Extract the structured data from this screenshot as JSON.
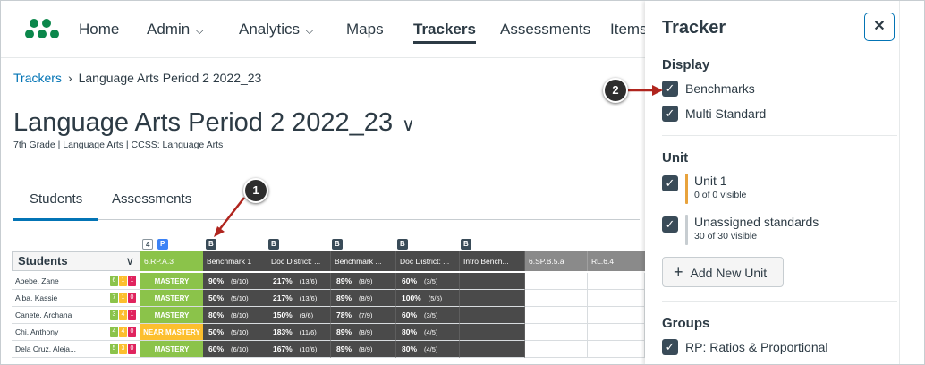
{
  "nav": {
    "items": [
      {
        "label": "Home"
      },
      {
        "label": "Admin"
      },
      {
        "label": "Analytics"
      },
      {
        "label": "Maps"
      },
      {
        "label": "Trackers"
      },
      {
        "label": "Assessments"
      },
      {
        "label": "Items"
      }
    ],
    "active": "Trackers"
  },
  "breadcrumb": {
    "parent": "Trackers",
    "current": "Language Arts Period 2 2022_23"
  },
  "page": {
    "title": "Language Arts Period 2 2022_23",
    "subtitle": "7th Grade  |  Language Arts  |  CCSS: Language Arts"
  },
  "tabs": [
    {
      "label": "Students"
    },
    {
      "label": "Assessments"
    }
  ],
  "grid": {
    "students_header": "Students",
    "badge_count": "4",
    "badge_p": "P",
    "badge_b": "B",
    "columns": [
      "6.RP.A.3",
      "Benchmark 1",
      "Doc District: ...",
      "Benchmark ...",
      "Doc District: ...",
      "Intro Bench...",
      "6.SP.B.5.a",
      "RL.6.4"
    ],
    "rows": [
      {
        "name": "Abebe, Zane",
        "chips": [
          "6",
          "1",
          "1"
        ],
        "mastery": "MASTERY",
        "mastery_color": "#8bc34a",
        "vals": [
          [
            "90%",
            "(9/10)"
          ],
          [
            "217%",
            "(13/6)"
          ],
          [
            "89%",
            "(8/9)"
          ],
          [
            "60%",
            "(3/5)"
          ]
        ]
      },
      {
        "name": "Alba, Kassie",
        "chips": [
          "7",
          "1",
          "0"
        ],
        "mastery": "MASTERY",
        "mastery_color": "#8bc34a",
        "vals": [
          [
            "50%",
            "(5/10)"
          ],
          [
            "217%",
            "(13/6)"
          ],
          [
            "89%",
            "(8/9)"
          ],
          [
            "100%",
            "(5/5)"
          ]
        ]
      },
      {
        "name": "Canete, Archana",
        "chips": [
          "3",
          "4",
          "1"
        ],
        "mastery": "MASTERY",
        "mastery_color": "#8bc34a",
        "vals": [
          [
            "80%",
            "(8/10)"
          ],
          [
            "150%",
            "(9/6)"
          ],
          [
            "78%",
            "(7/9)"
          ],
          [
            "60%",
            "(3/5)"
          ]
        ]
      },
      {
        "name": "Chi, Anthony",
        "chips": [
          "4",
          "4",
          "0"
        ],
        "mastery": "NEAR MASTERY",
        "mastery_color": "#fcbf2e",
        "vals": [
          [
            "50%",
            "(5/10)"
          ],
          [
            "183%",
            "(11/6)"
          ],
          [
            "89%",
            "(8/9)"
          ],
          [
            "80%",
            "(4/5)"
          ]
        ]
      },
      {
        "name": "Dela Cruz, Aleja...",
        "chips": [
          "5",
          "3",
          "0"
        ],
        "mastery": "MASTERY",
        "mastery_color": "#8bc34a",
        "vals": [
          [
            "60%",
            "(6/10)"
          ],
          [
            "167%",
            "(10/6)"
          ],
          [
            "89%",
            "(8/9)"
          ],
          [
            "80%",
            "(4/5)"
          ]
        ]
      }
    ],
    "chip_colors": [
      "#8bc34a",
      "#fcbf2e",
      "#e0245e"
    ]
  },
  "callouts": [
    {
      "label": "1"
    },
    {
      "label": "2"
    }
  ],
  "tray": {
    "title": "Tracker",
    "close_label": "✕",
    "display_heading": "Display",
    "display_options": [
      {
        "label": "Benchmarks",
        "checked": true
      },
      {
        "label": "Multi Standard",
        "checked": true
      }
    ],
    "unit_heading": "Unit",
    "units": [
      {
        "name": "Unit 1",
        "sub": "0 of 0 visible",
        "color": "#e8a33d"
      },
      {
        "name": "Unassigned standards",
        "sub": "30 of 30 visible",
        "color": "#c7cdd1"
      }
    ],
    "add_unit_label": "Add New Unit",
    "groups_heading": "Groups",
    "groups": [
      {
        "label": "RP: Ratios & Proportional",
        "checked": true
      }
    ]
  }
}
